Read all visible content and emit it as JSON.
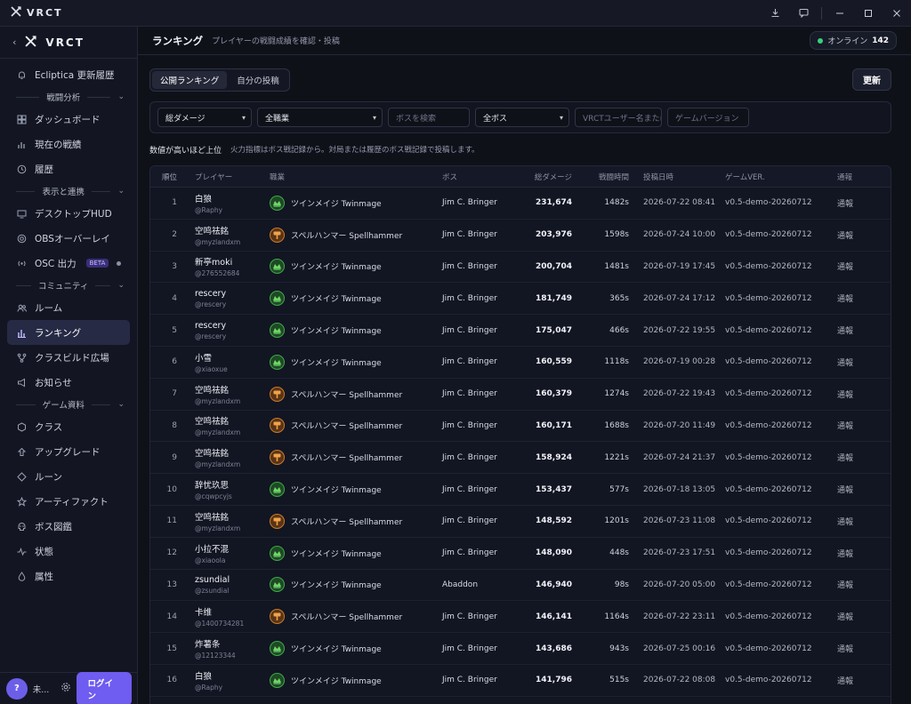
{
  "window": {
    "brand": "VRCT"
  },
  "sidebar": {
    "brand": "VRCT",
    "update_link": "Ecliptica 更新履歴",
    "sections": {
      "analysis": "戦闘分析",
      "display": "表示と連携",
      "community": "コミュニティ",
      "game": "ゲーム資料"
    },
    "items": {
      "dashboard": "ダッシュボード",
      "current": "現在の戦績",
      "history": "履歴",
      "hud": "デスクトップHUD",
      "obs": "OBSオーバーレイ",
      "osc": "OSC 出力",
      "osc_badge": "BETA",
      "room": "ルーム",
      "ranking": "ランキング",
      "build": "クラスビルド広場",
      "news": "お知らせ",
      "class": "クラス",
      "upgrade": "アップグレード",
      "rune": "ルーン",
      "artifact": "アーティファクト",
      "boss": "ボス図鑑",
      "status": "状態",
      "attr": "属性"
    },
    "footer": {
      "avatar": "?",
      "name": "未...",
      "login": "ログイン"
    }
  },
  "header": {
    "title": "ランキング",
    "subtitle": "プレイヤーの戦闘成績を確認・投稿",
    "online_label": "オンライン",
    "online_count": "142"
  },
  "tabs": {
    "public": "公開ランキング",
    "mine": "自分の投稿"
  },
  "refresh": "更新",
  "filters": {
    "metric": "総ダメージ",
    "job": "全職業",
    "boss_search_placeholder": "ボスを検索",
    "boss": "全ボス",
    "user_placeholder": "VRCTユーザー名または",
    "version_placeholder": "ゲームバージョン"
  },
  "notes": {
    "primary": "数値が高いほど上位",
    "secondary": "火力指標はボス戦記録から。対局または履歴のボス戦記録で投稿します。"
  },
  "table": {
    "headers": {
      "rank": "順位",
      "player": "プレイヤー",
      "job": "職業",
      "boss": "ボス",
      "damage": "総ダメージ",
      "time": "戦闘時間",
      "date": "投稿日時",
      "version": "ゲームVER.",
      "report": "通報"
    },
    "rows": [
      {
        "rank": "1",
        "name": "白狼",
        "handle": "@Raphy",
        "job": "ツインメイジ Twinmage",
        "jobtype": "green",
        "boss": "Jim C. Bringer",
        "damage": "231,674",
        "time": "1482s",
        "date": "2026-07-22 08:41",
        "version": "v0.5-demo-20260712",
        "report": "通報"
      },
      {
        "rank": "2",
        "name": "空鸣祛銘",
        "handle": "@myzlandxm",
        "job": "スペルハンマー Spellhammer",
        "jobtype": "orange",
        "boss": "Jim C. Bringer",
        "damage": "203,976",
        "time": "1598s",
        "date": "2026-07-24 10:00",
        "version": "v0.5-demo-20260712",
        "report": "通報"
      },
      {
        "rank": "3",
        "name": "新亭moki",
        "handle": "@276552684",
        "job": "ツインメイジ Twinmage",
        "jobtype": "green",
        "boss": "Jim C. Bringer",
        "damage": "200,704",
        "time": "1481s",
        "date": "2026-07-19 17:45",
        "version": "v0.5-demo-20260712",
        "report": "通報"
      },
      {
        "rank": "4",
        "name": "rescery",
        "handle": "@rescery",
        "job": "ツインメイジ Twinmage",
        "jobtype": "green",
        "boss": "Jim C. Bringer",
        "damage": "181,749",
        "time": "365s",
        "date": "2026-07-24 17:12",
        "version": "v0.5-demo-20260712",
        "report": "通報"
      },
      {
        "rank": "5",
        "name": "rescery",
        "handle": "@rescery",
        "job": "ツインメイジ Twinmage",
        "jobtype": "green",
        "boss": "Jim C. Bringer",
        "damage": "175,047",
        "time": "466s",
        "date": "2026-07-22 19:55",
        "version": "v0.5-demo-20260712",
        "report": "通報"
      },
      {
        "rank": "6",
        "name": "小雪",
        "handle": "@xiaoxue",
        "job": "ツインメイジ Twinmage",
        "jobtype": "green",
        "boss": "Jim C. Bringer",
        "damage": "160,559",
        "time": "1118s",
        "date": "2026-07-19 00:28",
        "version": "v0.5-demo-20260712",
        "report": "通報"
      },
      {
        "rank": "7",
        "name": "空鸣祛銘",
        "handle": "@myzlandxm",
        "job": "スペルハンマー Spellhammer",
        "jobtype": "orange",
        "boss": "Jim C. Bringer",
        "damage": "160,379",
        "time": "1274s",
        "date": "2026-07-22 19:43",
        "version": "v0.5-demo-20260712",
        "report": "通報"
      },
      {
        "rank": "8",
        "name": "空鸣祛銘",
        "handle": "@myzlandxm",
        "job": "スペルハンマー Spellhammer",
        "jobtype": "orange",
        "boss": "Jim C. Bringer",
        "damage": "160,171",
        "time": "1688s",
        "date": "2026-07-20 11:49",
        "version": "v0.5-demo-20260712",
        "report": "通報"
      },
      {
        "rank": "9",
        "name": "空鸣祛銘",
        "handle": "@myzlandxm",
        "job": "スペルハンマー Spellhammer",
        "jobtype": "orange",
        "boss": "Jim C. Bringer",
        "damage": "158,924",
        "time": "1221s",
        "date": "2026-07-24 21:37",
        "version": "v0.5-demo-20260712",
        "report": "通報"
      },
      {
        "rank": "10",
        "name": "辞忧玖思",
        "handle": "@cqwpcyjs",
        "job": "ツインメイジ Twinmage",
        "jobtype": "green",
        "boss": "Jim C. Bringer",
        "damage": "153,437",
        "time": "577s",
        "date": "2026-07-18 13:05",
        "version": "v0.5-demo-20260712",
        "report": "通報"
      },
      {
        "rank": "11",
        "name": "空鸣祛銘",
        "handle": "@myzlandxm",
        "job": "スペルハンマー Spellhammer",
        "jobtype": "orange",
        "boss": "Jim C. Bringer",
        "damage": "148,592",
        "time": "1201s",
        "date": "2026-07-23 11:08",
        "version": "v0.5-demo-20260712",
        "report": "通報"
      },
      {
        "rank": "12",
        "name": "小拉不混",
        "handle": "@xiaoola",
        "job": "ツインメイジ Twinmage",
        "jobtype": "green",
        "boss": "Jim C. Bringer",
        "damage": "148,090",
        "time": "448s",
        "date": "2026-07-23 17:51",
        "version": "v0.5-demo-20260712",
        "report": "通報"
      },
      {
        "rank": "13",
        "name": "zsundial",
        "handle": "@zsundial",
        "job": "ツインメイジ Twinmage",
        "jobtype": "green",
        "boss": "Abaddon",
        "damage": "146,940",
        "time": "98s",
        "date": "2026-07-20 05:00",
        "version": "v0.5-demo-20260712",
        "report": "通報"
      },
      {
        "rank": "14",
        "name": "卡维",
        "handle": "@1400734281",
        "job": "スペルハンマー Spellhammer",
        "jobtype": "orange",
        "boss": "Jim C. Bringer",
        "damage": "146,141",
        "time": "1164s",
        "date": "2026-07-22 23:11",
        "version": "v0.5-demo-20260712",
        "report": "通報"
      },
      {
        "rank": "15",
        "name": "炸薯条",
        "handle": "@12123344",
        "job": "ツインメイジ Twinmage",
        "jobtype": "green",
        "boss": "Jim C. Bringer",
        "damage": "143,686",
        "time": "943s",
        "date": "2026-07-25 00:16",
        "version": "v0.5-demo-20260712",
        "report": "通報"
      },
      {
        "rank": "16",
        "name": "白狼",
        "handle": "@Raphy",
        "job": "ツインメイジ Twinmage",
        "jobtype": "green",
        "boss": "Jim C. Bringer",
        "damage": "141,796",
        "time": "515s",
        "date": "2026-07-22 08:08",
        "version": "v0.5-demo-20260712",
        "report": "通報"
      }
    ]
  }
}
